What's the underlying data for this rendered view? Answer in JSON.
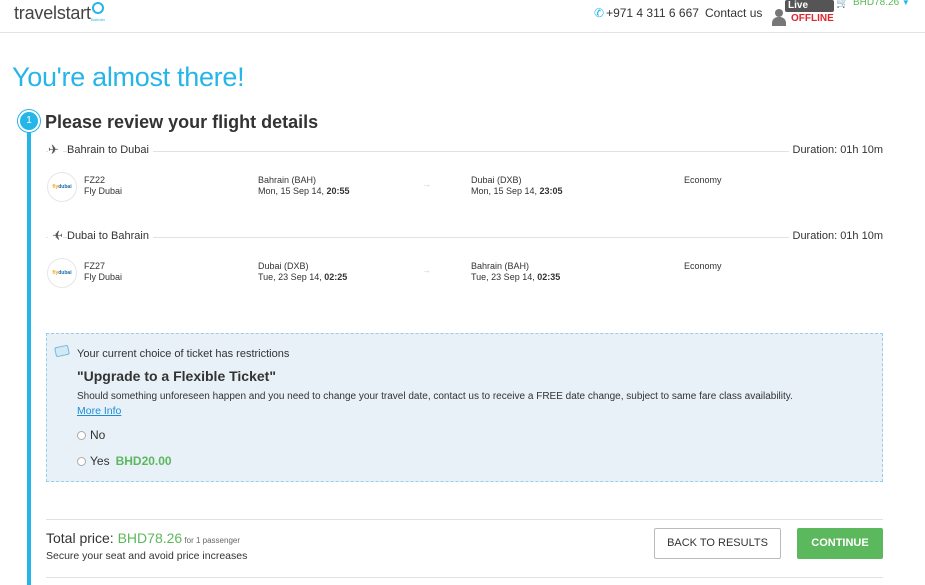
{
  "header": {
    "logo_text": "travelstart",
    "logo_sub": "Bahrain",
    "phone": "+971 4 311 6 667",
    "contact": "Contact us",
    "livechat_label": "Live Chat",
    "livechat_status": "OFFLINE",
    "cart_total": "BHD78.26",
    "icons": [
      "phone-icon",
      "user-icon",
      "cart-icon",
      "caret-down-icon"
    ]
  },
  "page_title": "You're almost there!",
  "step": {
    "number": "1",
    "title": "Please review your flight details"
  },
  "legs": [
    {
      "route": "Bahrain to Dubai",
      "duration": "Duration: 01h 10m",
      "airline_logo": "flydubai",
      "flight_no": "FZ22",
      "airline": "Fly Dubai",
      "dep_airport": "Bahrain (BAH)",
      "dep_date": "Mon, 15 Sep 14, ",
      "dep_time": "20:55",
      "arrow": "→",
      "arr_airport": "Dubai (DXB)",
      "arr_date": "Mon, 15 Sep 14, ",
      "arr_time": "23:05",
      "cabin": "Economy"
    },
    {
      "route": "Dubai to Bahrain",
      "duration": "Duration: 01h 10m",
      "airline_logo": "flydubai",
      "flight_no": "FZ27",
      "airline": "Fly Dubai",
      "dep_airport": "Dubai (DXB)",
      "dep_date": "Tue, 23 Sep 14, ",
      "dep_time": "02:25",
      "arrow": "→",
      "arr_airport": "Bahrain (BAH)",
      "arr_date": "Tue, 23 Sep 14, ",
      "arr_time": "02:35",
      "cabin": "Economy"
    }
  ],
  "restriction": {
    "message": "Your current choice of ticket has restrictions",
    "upgrade_title": "\"Upgrade to a Flexible Ticket\"",
    "description": "Should something unforeseen happen and you need to change your travel date, contact us to receive a FREE date change, subject to same fare class availability.",
    "more_info": "More Info",
    "options": [
      {
        "label": "No",
        "price": ""
      },
      {
        "label": "Yes",
        "price": "BHD20.00"
      }
    ]
  },
  "footer": {
    "total_label": "Total price: ",
    "total_amount": "BHD78.26",
    "total_pax": " for 1 passenger",
    "secure_text": "Secure your seat and avoid price increases",
    "back_button": "BACK TO RESULTS",
    "continue_button": "CONTINUE"
  },
  "colors": {
    "accent": "#25b5e8",
    "price_green": "#5cb85c",
    "offline_red": "#e0262d",
    "notice_bg": "#e7f1f7"
  }
}
